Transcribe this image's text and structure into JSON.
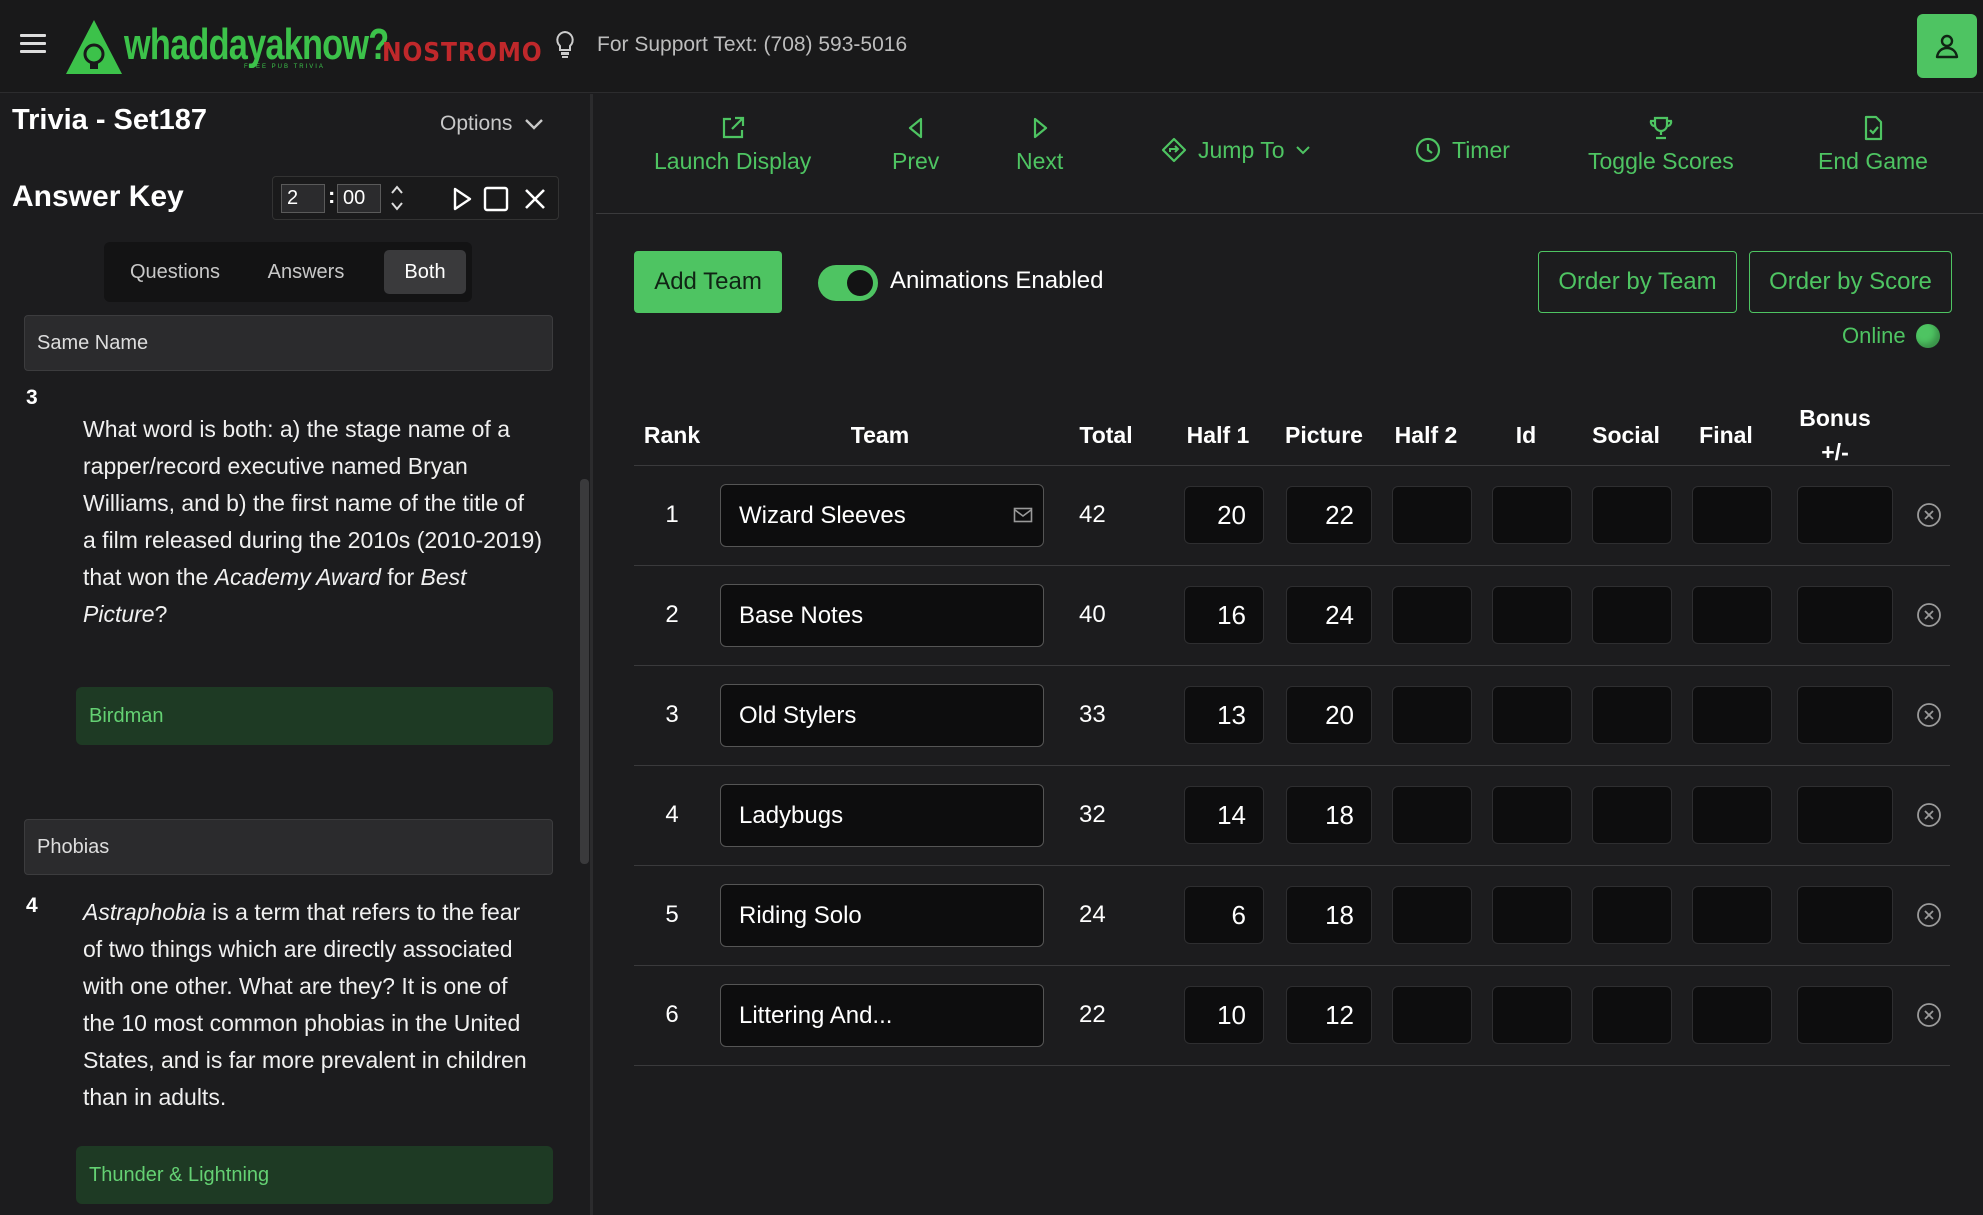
{
  "header": {
    "logo_text": "whaddayaknow?",
    "logo_sub": "FREE PUB TRIVIA",
    "partner": "NOSTROMO",
    "support_text": "For Support Text: (708) 593-5016"
  },
  "left": {
    "set_title": "Trivia - Set187",
    "options_label": "Options",
    "answer_key_title": "Answer Key",
    "timer": {
      "minutes": "2",
      "colon": ":",
      "seconds": "00"
    },
    "segments": [
      "Questions",
      "Answers",
      "Both"
    ],
    "active_segment": "Both",
    "questions": [
      {
        "category": "Same Name",
        "number": "3",
        "text_parts": [
          "What word is both: a) the stage name of a rapper/record executive named Bryan Williams, and b) the first name of the title of a film released during the 2010s (2010-2019) that won the ",
          "Academy Award",
          " for ",
          "Best Picture",
          "?"
        ],
        "answer": "Birdman"
      },
      {
        "category": "Phobias",
        "number": "4",
        "text_parts": [
          "Astraphobia",
          " is a term that refers to the fear of two things which are directly associated with one other. What are they? It is one of the 10 most common phobias in the United States, and is far more prevalent in children than in adults."
        ],
        "answer": "Thunder & Lightning"
      }
    ]
  },
  "toolbar": {
    "launch": "Launch Display",
    "prev": "Prev",
    "next": "Next",
    "jump": "Jump To",
    "timer": "Timer",
    "toggle_scores": "Toggle Scores",
    "end_game": "End Game"
  },
  "main": {
    "add_team": "Add Team",
    "animations": "Animations Enabled",
    "animations_on": true,
    "order_team": "Order by Team",
    "order_score": "Order by Score",
    "online": "Online",
    "columns": [
      "Rank",
      "Team",
      "Total",
      "Half 1",
      "Picture",
      "Half 2",
      "Id",
      "Social",
      "Final",
      "Bonus +/-"
    ],
    "rows": [
      {
        "rank": "1",
        "team": "Wizard Sleeves",
        "total": "42",
        "half1": "20",
        "picture": "22",
        "half2": "",
        "id": "",
        "social": "",
        "final": "",
        "bonus": "",
        "has_mail": true
      },
      {
        "rank": "2",
        "team": "Base Notes",
        "total": "40",
        "half1": "16",
        "picture": "24",
        "half2": "",
        "id": "",
        "social": "",
        "final": "",
        "bonus": ""
      },
      {
        "rank": "3",
        "team": "Old Stylers",
        "total": "33",
        "half1": "13",
        "picture": "20",
        "half2": "",
        "id": "",
        "social": "",
        "final": "",
        "bonus": ""
      },
      {
        "rank": "4",
        "team": "Ladybugs",
        "total": "32",
        "half1": "14",
        "picture": "18",
        "half2": "",
        "id": "",
        "social": "",
        "final": "",
        "bonus": ""
      },
      {
        "rank": "5",
        "team": "Riding Solo",
        "total": "24",
        "half1": "6",
        "picture": "18",
        "half2": "",
        "id": "",
        "social": "",
        "final": "",
        "bonus": ""
      },
      {
        "rank": "6",
        "team": "Littering And...",
        "total": "22",
        "half1": "10",
        "picture": "12",
        "half2": "",
        "id": "",
        "social": "",
        "final": "",
        "bonus": ""
      }
    ]
  },
  "colors": {
    "accent": "#4ec462",
    "background": "#1c1c1e",
    "answer_bg": "#1e3a24",
    "partner": "#c0282b"
  },
  "icons": [
    "menu-icon",
    "lightbulb-icon",
    "user-icon",
    "chevron-down-icon",
    "play-icon",
    "stop-icon",
    "close-icon",
    "external-link-icon",
    "caret-left-icon",
    "caret-right-icon",
    "diamond-arrow-icon",
    "clock-icon",
    "trophy-icon",
    "file-check-icon",
    "mail-icon",
    "remove-circle-icon"
  ]
}
